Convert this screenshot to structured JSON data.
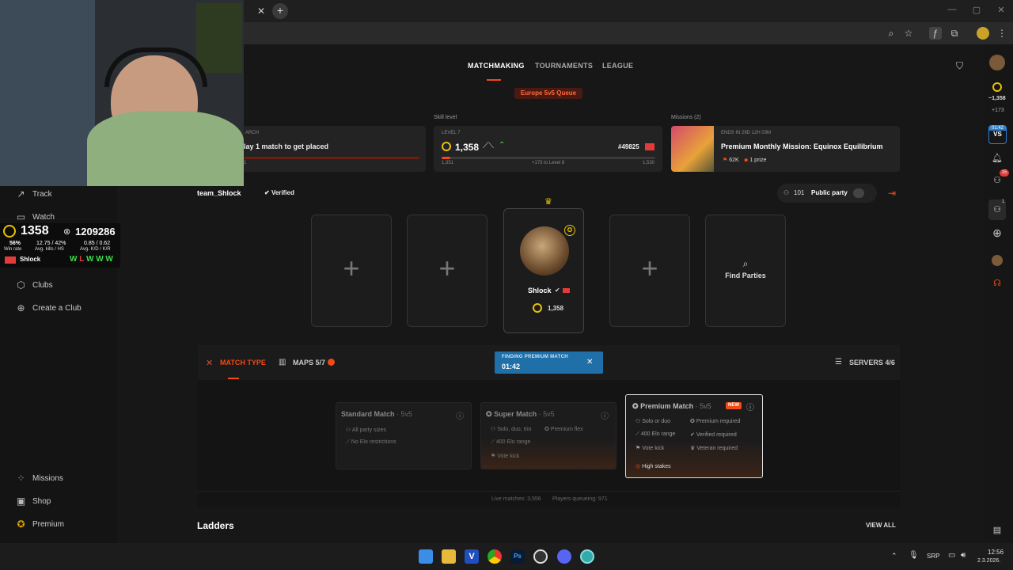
{
  "nav": {
    "matchmaking": "MATCHMAKING",
    "tournaments": "TOURNAMENTS",
    "league": "LEAGUE"
  },
  "queue_badge": "Europe 5v5 Queue",
  "search_card": {
    "label": "ARCH",
    "title": "lay 1 match to get placed",
    "foot": "1"
  },
  "skill": {
    "section": "Skill level",
    "level": "LEVEL 7",
    "elo": "1,358",
    "rank": "#49825",
    "min": "1,351",
    "progress_text": "+173 to Level 8",
    "max": "1,530",
    "progress": 0.04
  },
  "missions": {
    "section": "Missions (2)",
    "ends": "ENDS IN 29D 12H 03M",
    "title": "Premium Monthly Mission: Equinox Equilibrium",
    "points": "62K",
    "prize": "1 prize"
  },
  "party": {
    "team": "team_Shlock",
    "verified": "Verified",
    "count": "101",
    "type": "Public party"
  },
  "player": {
    "name": "Shlock",
    "elo": "1,358",
    "level": "7"
  },
  "find_parties": "Find Parties",
  "match_tabs": {
    "match_type": "MATCH TYPE",
    "maps": "MAPS 5/7",
    "servers": "SERVERS 4/6"
  },
  "finding": {
    "label": "FINDING PREMIUM MATCH",
    "time": "01:42"
  },
  "match_cards": [
    {
      "title": "Standard Match",
      "mode": "· 5v5",
      "features": [
        "All party sizes",
        "No Elo restrictions"
      ]
    },
    {
      "title": "Super Match",
      "mode": "· 5v5",
      "features": [
        "Solo, duo, trio",
        "400 Elo range",
        "Vote kick"
      ],
      "extra": [
        "Premium flex"
      ]
    },
    {
      "title": "Premium Match",
      "mode": "· 5v5",
      "badge": "NEW",
      "features": [
        "Solo or duo",
        "400 Elo range",
        "Vote kick"
      ],
      "extra": [
        "Premium required",
        "Verified required",
        "Veteran required"
      ],
      "footer": "High stakes"
    }
  ],
  "stats": {
    "live": "Live matches: 3,556",
    "queue": "Players queueing: 971"
  },
  "ladders": {
    "title": "Ladders",
    "view_all": "VIEW ALL"
  },
  "sidebar": {
    "items": [
      "Track",
      "Watch",
      "Clubs",
      "Create a Club",
      "Missions",
      "Shop",
      "Premium"
    ]
  },
  "overlay": {
    "elo": "1358",
    "score": "1209286",
    "winrate": "56%",
    "winrate_label": "Win rate",
    "kills": "12.75 / 42%",
    "kills_label": "Avg. kills / HS",
    "kd": "0.85 / 0.62",
    "kd_label": "Avg. K/D / K/R",
    "name": "Shlock",
    "streak": [
      "W",
      "L",
      "W",
      "W",
      "W"
    ]
  },
  "rail": {
    "elo": "~1,358",
    "delta": "+173",
    "badge_time": "01:42",
    "vs": "VS",
    "friends_badge": "15",
    "badge1": "1"
  },
  "taskbar": {
    "lang": "SRP",
    "time": "12:56",
    "date": "2.3.2026."
  },
  "colors": {
    "accent": "#f04a16",
    "finding_bg": "#1f6fa8",
    "win": "#3ddc4a",
    "loss": "#e23b3b"
  }
}
